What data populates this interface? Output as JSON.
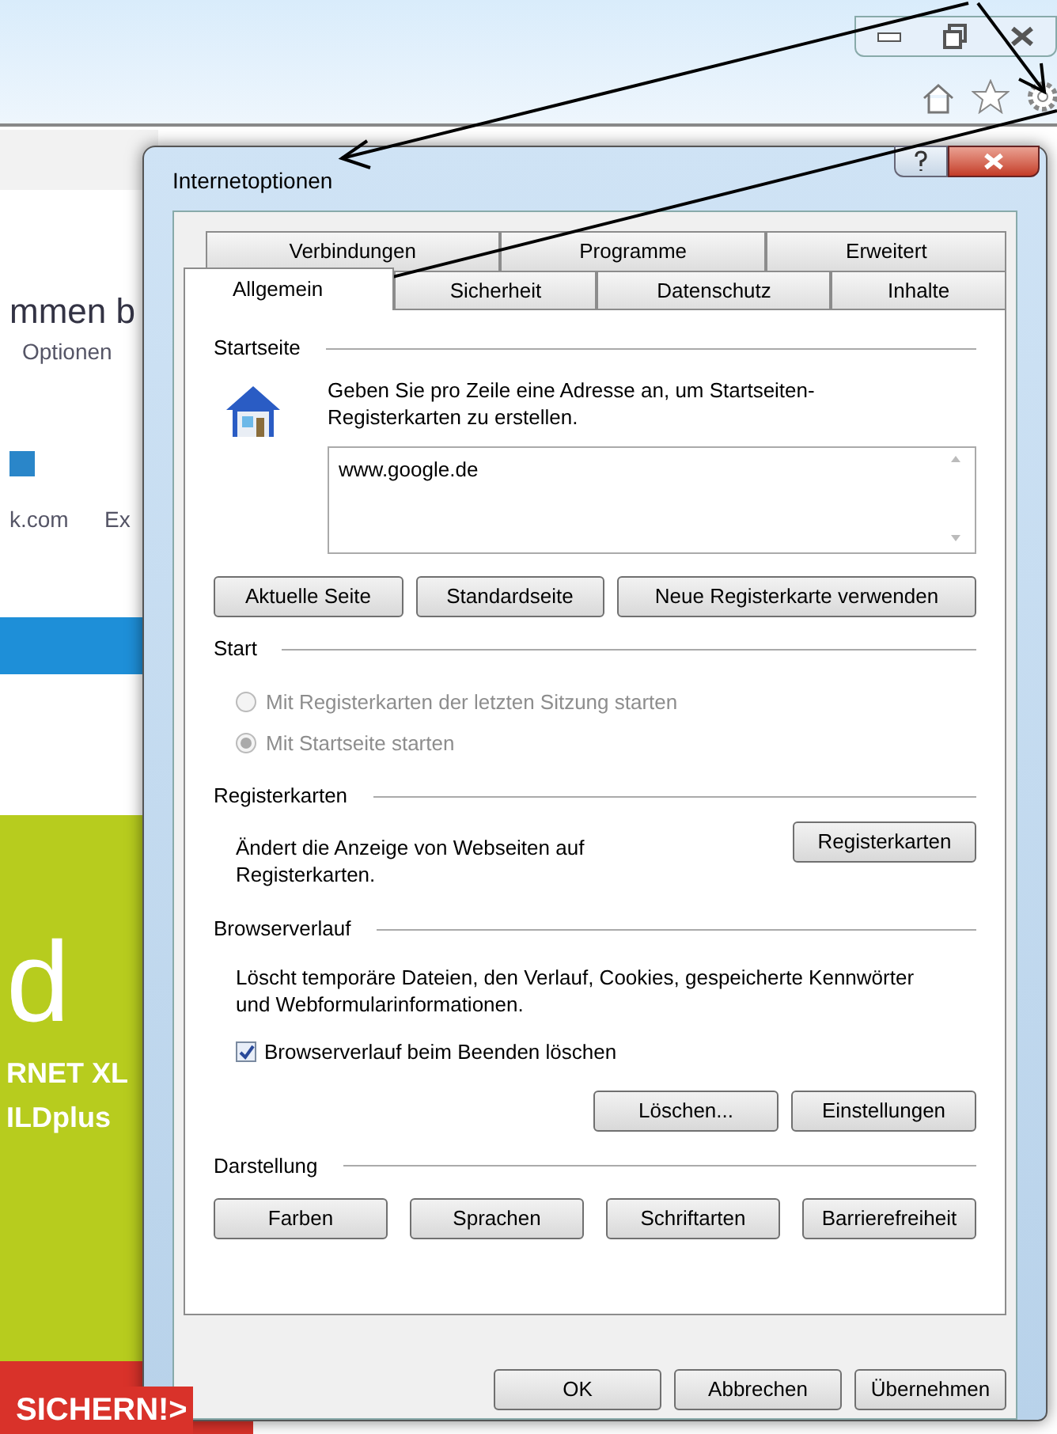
{
  "background_page": {
    "texts": [
      {
        "kind": "heading",
        "text": "mmen b"
      },
      {
        "kind": "link",
        "text": "Optionen"
      },
      {
        "kind": "link",
        "text": "k.com"
      },
      {
        "kind": "link",
        "text": "Ex"
      },
      {
        "kind": "ad_big",
        "text": "d"
      },
      {
        "kind": "ad_line",
        "text": "RNET XL"
      },
      {
        "kind": "ad_line",
        "text": "ILDplus"
      },
      {
        "kind": "ad_cta",
        "text": "SICHERN!>"
      }
    ]
  },
  "dialog": {
    "title": "Internetoptionen",
    "tab_rows": [
      [
        {
          "label": "Verbindungen",
          "selected": false
        },
        {
          "label": "Programme",
          "selected": false
        },
        {
          "label": "Erweitert",
          "selected": false
        }
      ],
      [
        {
          "label": "Allgemein",
          "selected": true
        },
        {
          "label": "Sicherheit",
          "selected": false
        },
        {
          "label": "Datenschutz",
          "selected": false
        },
        {
          "label": "Inhalte",
          "selected": false
        }
      ]
    ],
    "sections": [
      {
        "kind": "homepage",
        "title": "Startseite",
        "description": "Geben Sie pro Zeile eine Adresse an, um Startseiten-Registerkarten zu erstellen.",
        "value": "www.google.de",
        "buttons": [
          "Aktuelle Seite",
          "Standardseite",
          "Neue Registerkarte verwenden"
        ]
      },
      {
        "kind": "radios",
        "title": "Start",
        "options": [
          {
            "label": "Mit Registerkarten der letzten Sitzung starten",
            "selected": false,
            "disabled": true
          },
          {
            "label": "Mit Startseite starten",
            "selected": true,
            "disabled": true
          }
        ]
      },
      {
        "kind": "text_button",
        "title": "Registerkarten",
        "description": "Ändert die Anzeige von Webseiten auf Registerkarten.",
        "buttons": [
          "Registerkarten"
        ]
      },
      {
        "kind": "history",
        "title": "Browserverlauf",
        "description": "Löscht temporäre Dateien, den Verlauf, Cookies, gespeicherte Kennwörter und Webformularinformationen.",
        "checkbox": {
          "label": "Browserverlauf beim Beenden löschen",
          "checked": true
        },
        "buttons": [
          "Löschen...",
          "Einstellungen"
        ]
      },
      {
        "kind": "buttons",
        "title": "Darstellung",
        "buttons": [
          "Farben",
          "Sprachen",
          "Schriftarten",
          "Barrierefreiheit"
        ]
      }
    ],
    "buttons": [
      "OK",
      "Abbrechen",
      "Übernehmen"
    ]
  }
}
